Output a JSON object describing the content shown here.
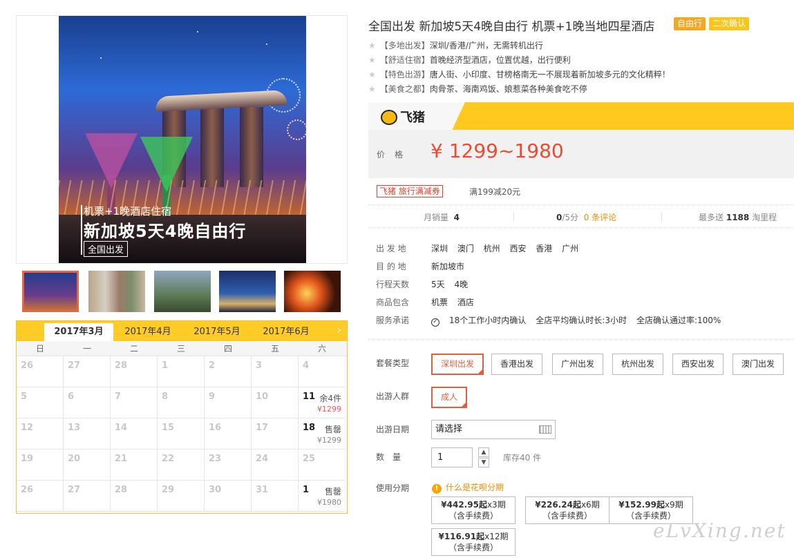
{
  "gallery": {
    "caption_line1": "机票+1晚酒店住宿",
    "caption_line2": "新加坡5天4晚自由行",
    "caption_tag": "全国出发"
  },
  "calendar": {
    "months": [
      "2017年3月",
      "2017年4月",
      "2017年5月",
      "2017年6月"
    ],
    "weekdays": [
      "日",
      "一",
      "二",
      "三",
      "四",
      "五",
      "六"
    ],
    "next_icon": "chevron-right-icon",
    "rows": [
      [
        {
          "d": "26"
        },
        {
          "d": "27"
        },
        {
          "d": "28"
        },
        {
          "d": "1"
        },
        {
          "d": "2"
        },
        {
          "d": "3"
        },
        {
          "d": "4"
        }
      ],
      [
        {
          "d": "5"
        },
        {
          "d": "6"
        },
        {
          "d": "7"
        },
        {
          "d": "8"
        },
        {
          "d": "9"
        },
        {
          "d": "10"
        },
        {
          "d": "11",
          "s": "余4件",
          "p": "¥1299"
        }
      ],
      [
        {
          "d": "12"
        },
        {
          "d": "13"
        },
        {
          "d": "14"
        },
        {
          "d": "15"
        },
        {
          "d": "16"
        },
        {
          "d": "17"
        },
        {
          "d": "18",
          "s": "售罄",
          "p": "¥1299"
        }
      ],
      [
        {
          "d": "19"
        },
        {
          "d": "20"
        },
        {
          "d": "21"
        },
        {
          "d": "22"
        },
        {
          "d": "23"
        },
        {
          "d": "24"
        },
        {
          "d": "25"
        }
      ],
      [
        {
          "d": "26"
        },
        {
          "d": "27"
        },
        {
          "d": "28"
        },
        {
          "d": "29"
        },
        {
          "d": "30"
        },
        {
          "d": "31"
        },
        {
          "d": "1",
          "s": "售罄",
          "p": "¥1980"
        }
      ]
    ]
  },
  "product": {
    "title": "全国出发 新加坡5天4晚自由行 机票+1晚当地四星酒店",
    "badge1": "自由行",
    "badge2": "二次确认",
    "features": [
      {
        "tag": "【多地出发】",
        "text": "深圳/香港/广州，无需转机出行"
      },
      {
        "tag": "【舒适住宿】",
        "text": "首晚经济型酒店，位置优越，出行便利"
      },
      {
        "tag": "【特色出游】",
        "text": "唐人街、小印度、甘榜格南无一不展现着新加坡多元的文化精粹！"
      },
      {
        "tag": "【美食之都】",
        "text": "肉骨茶、海南鸡饭、娘惹菜各种美食吃不停"
      }
    ]
  },
  "price": {
    "brand": "飞猪",
    "label": "价格",
    "value": "¥ 1299~1980",
    "coupon": "飞猪 旅行满减券",
    "coupon_desc": "满199减20元"
  },
  "stats": {
    "monthly_label": "月销量",
    "monthly_value": "4",
    "rating_value": "0",
    "rating_suffix": "/5分",
    "reviews": "0 条评论",
    "points_prefix": "最多送",
    "points_value": "1188",
    "points_suffix": "淘里程"
  },
  "info": {
    "depart_label": "出 发 地",
    "depart_value": "深圳 澳门 杭州 西安 香港 广州",
    "dest_label": "目 的 地",
    "dest_value": "新加坡市",
    "days_label": "行程天数",
    "days_value": "5天 4晚",
    "include_label": "商品包含",
    "include_value": "机票 酒店",
    "promise_label": "服务承诺",
    "promise_items": [
      "18个工作小时内确认",
      "全店平均确认时长:3小时",
      "全店确认通过率:100%"
    ]
  },
  "options": {
    "package_label": "套餐类型",
    "packages": [
      "深圳出发",
      "香港出发",
      "广州出发",
      "杭州出发",
      "西安出发",
      "澳门出发"
    ],
    "selected_package": "深圳出发",
    "people_label": "出游人群",
    "people": [
      "成人"
    ],
    "date_label": "出游日期",
    "date_placeholder": "请选择",
    "qty_label": "数　量",
    "qty_value": "1",
    "stock": "库存40 件",
    "installment_label": "使用分期",
    "huabei_link": "什么是花呗分期",
    "installments": [
      {
        "amount": "¥442.95起",
        "period": "x3期",
        "fee": "（含手续费）"
      },
      {
        "amount": "¥226.24起",
        "period": "x6期",
        "fee": "（含手续费）"
      },
      {
        "amount": "¥152.99起",
        "period": "x9期",
        "fee": "（含手续费）"
      },
      {
        "amount": "¥116.91起",
        "period": "x12期",
        "fee": "（含手续费）"
      }
    ]
  },
  "watermark": "eLvXing.net",
  "colors": {
    "accent": "#ffcb27",
    "price": "#e94b34",
    "selected": "#e55d3f",
    "link": "#f08c00"
  }
}
